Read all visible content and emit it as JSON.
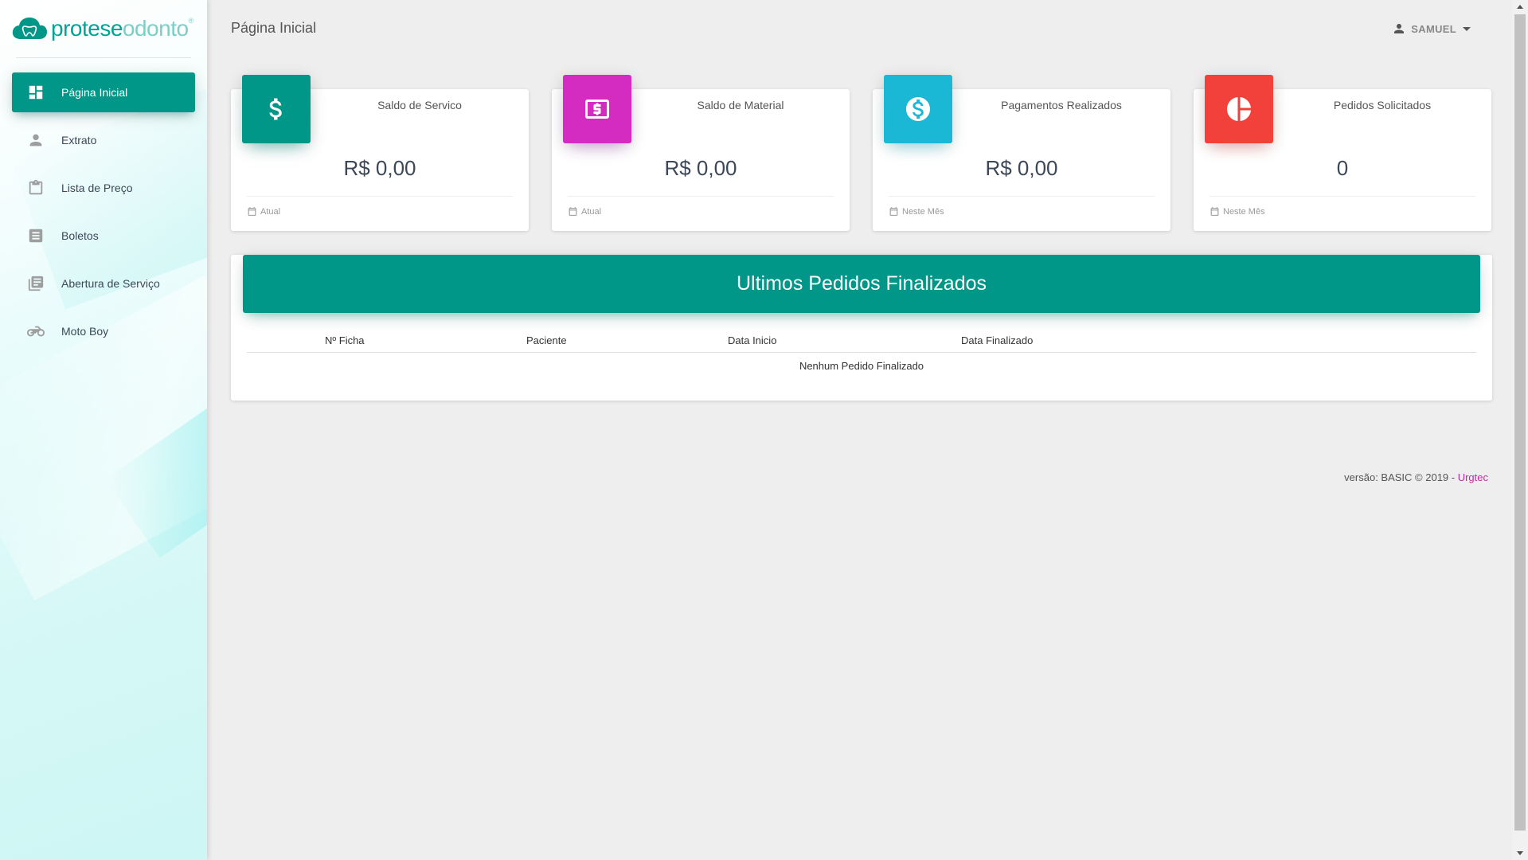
{
  "brand": {
    "part1": "protese",
    "part2": "odonto",
    "mark": "®"
  },
  "sidebar": {
    "items": [
      {
        "label": "Página Inicial",
        "icon": "dashboard-icon",
        "active": true
      },
      {
        "label": "Extrato",
        "icon": "person-icon"
      },
      {
        "label": "Lista de Preço",
        "icon": "clipboard-icon"
      },
      {
        "label": "Boletos",
        "icon": "list-doc-icon"
      },
      {
        "label": "Abertura de Serviço",
        "icon": "library-books-icon"
      },
      {
        "label": "Moto Boy",
        "icon": "motorcycle-icon"
      }
    ]
  },
  "header": {
    "title": "Página Inicial",
    "user": "SAMUEL"
  },
  "cards": [
    {
      "category": "Saldo de Servico",
      "value": "R$ 0,00",
      "footer": "Atual",
      "color": "#009688",
      "icon": "dollar-icon"
    },
    {
      "category": "Saldo de Material",
      "value": "R$ 0,00",
      "footer": "Atual",
      "color": "#d42bc0",
      "icon": "money-bill-icon"
    },
    {
      "category": "Pagamentos Realizados",
      "value": "R$ 0,00",
      "footer": "Neste Mês",
      "color": "#1ab8d4",
      "icon": "dollar-circle-icon"
    },
    {
      "category": "Pedidos Solicitados",
      "value": "0",
      "footer": "Neste Mês",
      "color": "#f2413b",
      "icon": "pie-chart-icon"
    }
  ],
  "orders": {
    "title": "Ultimos Pedidos Finalizados",
    "columns": [
      "Nº Ficha",
      "Paciente",
      "Data Inicio",
      "Data Finalizado"
    ],
    "empty_message": "Nenhum Pedido Finalizado"
  },
  "footer": {
    "text": "versão: BASIC © 2019 - ",
    "brand": "Urgtec"
  },
  "colors": {
    "accent": "#009688",
    "link": "#c02aa8"
  }
}
